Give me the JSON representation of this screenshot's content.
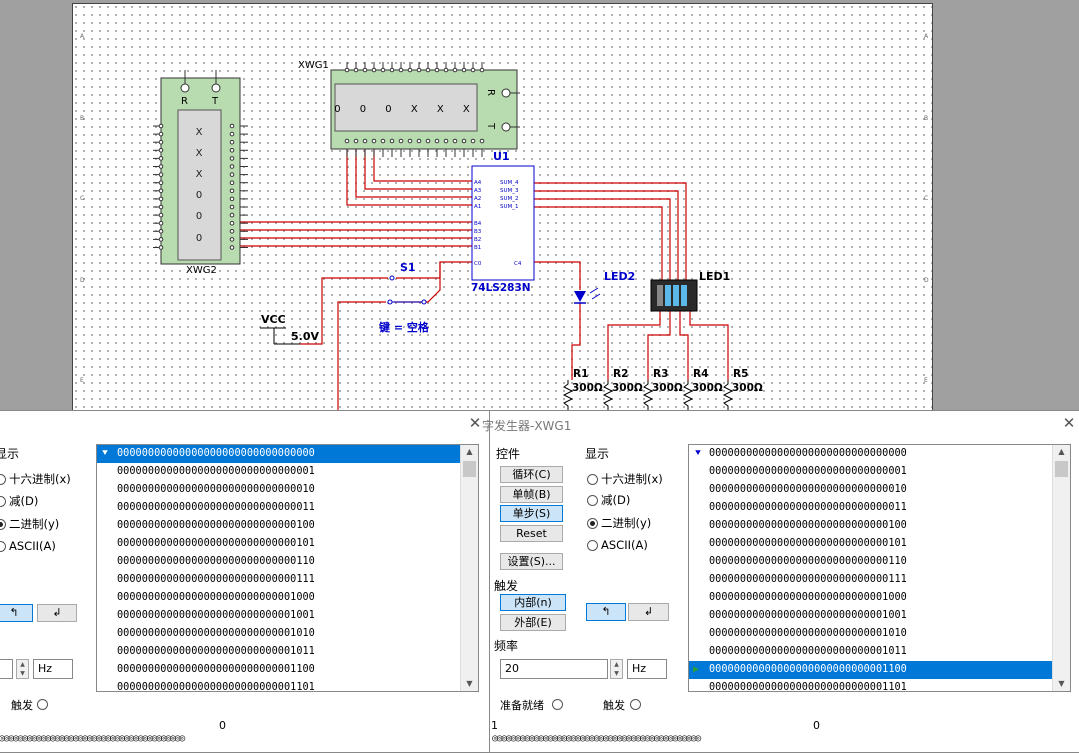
{
  "schematic": {
    "xwg1_label": "XWG1",
    "xwg2_label": "XWG2",
    "xwg1_display": "0 0 0 X X X",
    "xwg2_display": [
      "X",
      "X",
      "X",
      "0",
      "0",
      "0"
    ],
    "terminal_R": "R",
    "terminal_T": "T",
    "u1_label": "U1",
    "u1_part": "74LS283N",
    "s1_label": "S1",
    "switch_key": "键 = 空格",
    "vcc_label": "VCC",
    "vcc_value": "5.0V",
    "led1_label": "LED1",
    "led2_label": "LED2",
    "resistors": [
      {
        "name": "R1",
        "value": "300Ω"
      },
      {
        "name": "R2",
        "value": "300Ω"
      },
      {
        "name": "R3",
        "value": "300Ω"
      },
      {
        "name": "R4",
        "value": "300Ω"
      },
      {
        "name": "R5",
        "value": "300Ω"
      }
    ],
    "u1_pins_left": [
      "A4",
      "A3",
      "A2",
      "A1",
      "B4",
      "B3",
      "B2",
      "B1",
      "C0"
    ],
    "u1_pins_right": [
      "SUM_4",
      "SUM_3",
      "SUM_2",
      "SUM_1",
      "C4"
    ],
    "border_letters": [
      "A",
      "B",
      "C",
      "D",
      "E"
    ]
  },
  "left_dialog": {
    "display_label": "显示",
    "radios": [
      "十六进制(x)",
      "减(D)",
      "二进制(y)",
      "ASCII(A)"
    ],
    "selected_radio": "二进制(y)",
    "rows": [
      "00000000000000000000000000000000",
      "00000000000000000000000000000001",
      "00000000000000000000000000000010",
      "00000000000000000000000000000011",
      "00000000000000000000000000000100",
      "00000000000000000000000000000101",
      "00000000000000000000000000000110",
      "00000000000000000000000000000111",
      "00000000000000000000000000001000",
      "00000000000000000000000000001001",
      "00000000000000000000000000001010",
      "00000000000000000000000000001011",
      "00000000000000000000000000001100",
      "00000000000000000000000000001101"
    ],
    "freq_unit": "Hz",
    "trigger_label": "触发",
    "bit_index": "0",
    "bits": "◎◎◎◎◎◎◎◎◎◎◎◎◎◎◎◎◎◎◎◎◎◎◎◎◎◎◎◎◎◎◎◎◎◎◎◎◎◎◎◎"
  },
  "right_dialog": {
    "title": "字发生器-XWG1",
    "controls_label": "控件",
    "buttons": [
      "循环(C)",
      "单帧(B)",
      "单步(S)",
      "Reset"
    ],
    "settings_button": "设置(S)...",
    "display_label": "显示",
    "radios": [
      "十六进制(x)",
      "减(D)",
      "二进制(y)",
      "ASCII(A)"
    ],
    "selected_radio": "二进制(y)",
    "trigger_label": "触发",
    "trigger_internal": "内部(n)",
    "trigger_external": "外部(E)",
    "rising_icon_label": "↑",
    "freq_label": "频率",
    "freq_value": "20",
    "freq_unit": "Hz",
    "ready_label": "准备就绪",
    "trigger_bottom": "触发",
    "rows": [
      "00000000000000000000000000000000",
      "00000000000000000000000000000001",
      "00000000000000000000000000000010",
      "00000000000000000000000000000011",
      "00000000000000000000000000000100",
      "00000000000000000000000000000101",
      "00000000000000000000000000000110",
      "00000000000000000000000000000111",
      "00000000000000000000000000001000",
      "00000000000000000000000000001001",
      "00000000000000000000000000001010",
      "00000000000000000000000000001011",
      "00000000000000000000000000001100",
      "00000000000000000000000000001101"
    ],
    "bit_index_left": "1",
    "bit_index": "0",
    "bits": "◎◎◎◎◎◎◎◎◎◎◎◎◎◎◎◎◎◎◎◎◎◎◎◎◎◎◎◎◎◎◎◎◎◎◎◎◎◎◎◎◎◎◎◎◎"
  },
  "colors": {
    "wire": "#cc0000",
    "component": "#0000cc",
    "instrument": "#b8dcb0",
    "selection": "#0078d7"
  }
}
